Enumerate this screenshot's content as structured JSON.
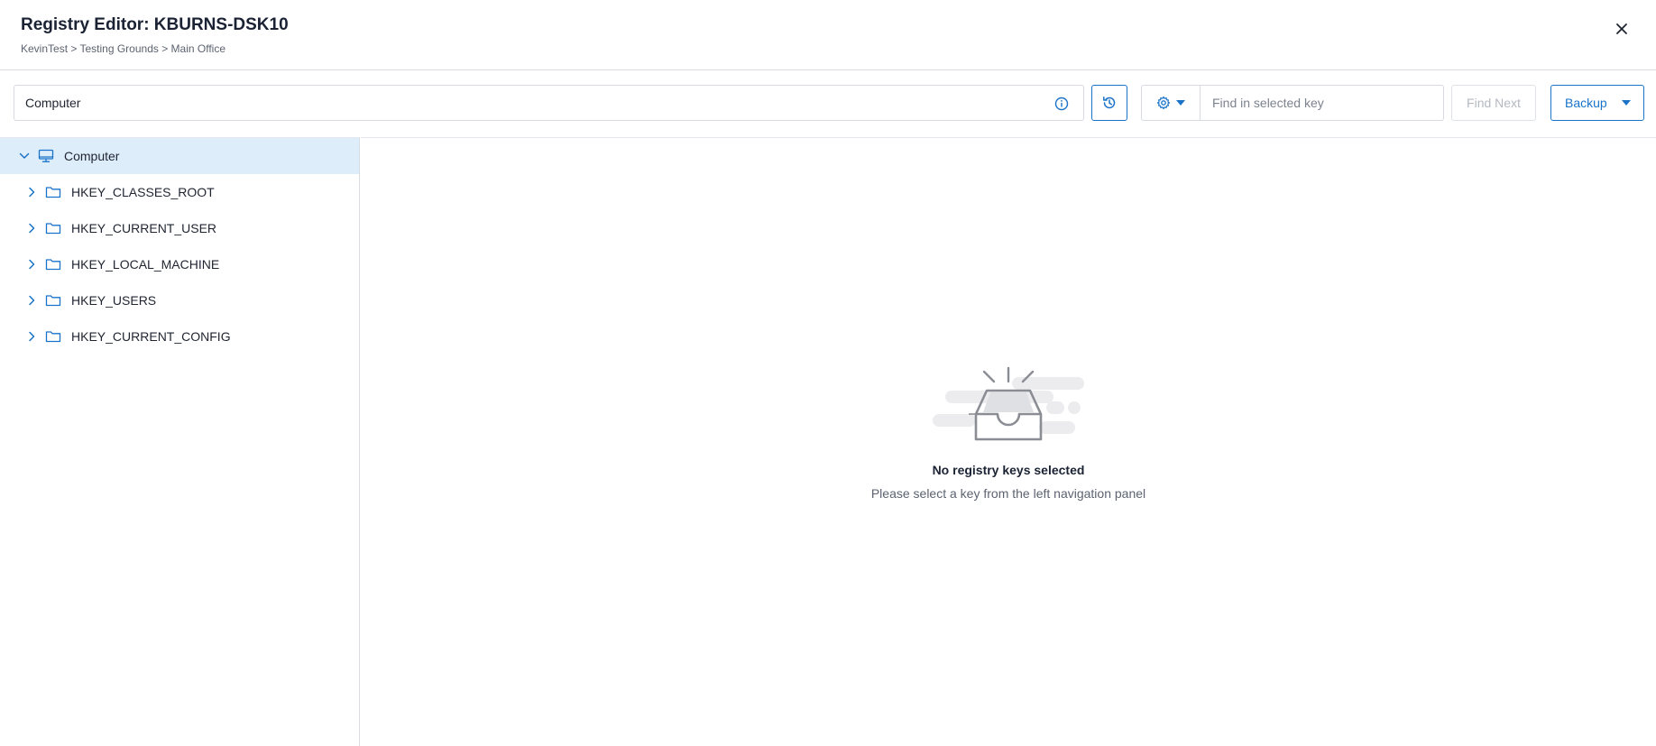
{
  "header": {
    "title": "Registry Editor: KBURNS-DSK10",
    "breadcrumb": "KevinTest > Testing Grounds > Main Office"
  },
  "toolbar": {
    "path_value": "Computer",
    "search_placeholder": "Find in selected key",
    "find_next_label": "Find Next",
    "backup_label": "Backup"
  },
  "tree": {
    "root": {
      "label": "Computer",
      "icon": "monitor-icon",
      "expanded": true,
      "selected": true
    },
    "children": [
      {
        "label": "HKEY_CLASSES_ROOT",
        "icon": "folder-icon"
      },
      {
        "label": "HKEY_CURRENT_USER",
        "icon": "folder-icon"
      },
      {
        "label": "HKEY_LOCAL_MACHINE",
        "icon": "folder-icon"
      },
      {
        "label": "HKEY_USERS",
        "icon": "folder-icon"
      },
      {
        "label": "HKEY_CURRENT_CONFIG",
        "icon": "folder-icon"
      }
    ]
  },
  "empty_state": {
    "title": "No registry keys selected",
    "subtitle": "Please select a key from the left navigation panel"
  },
  "colors": {
    "accent": "#1a73c9",
    "selected_row": "#ddeefa",
    "border": "#d9dde3"
  }
}
